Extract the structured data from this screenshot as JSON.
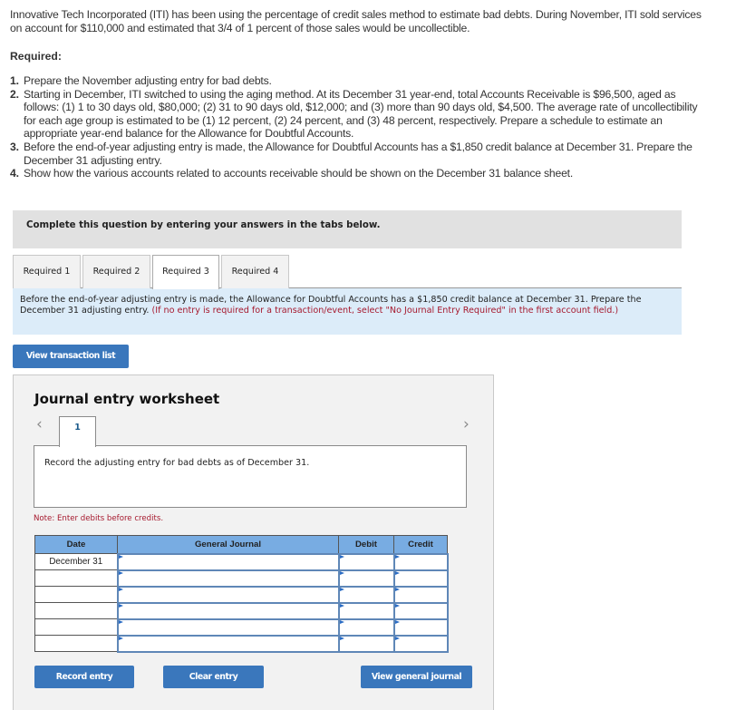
{
  "problem": {
    "intro": "Innovative Tech Incorporated (ITI) has been using the percentage of credit sales method to estimate bad debts. During November, ITI sold services on account for $110,000 and estimated that 3/4 of 1 percent of those sales would be uncollectible.",
    "required_title": "Required:",
    "requirements": [
      {
        "num": "1.",
        "text": "Prepare the November adjusting entry for bad debts."
      },
      {
        "num": "2.",
        "text": "Starting in December, ITI switched to using the aging method. At its December 31 year-end, total Accounts Receivable is $96,500, aged as follows: (1) 1 to 30 days old, $80,000; (2) 31 to 90 days old, $12,000; and (3) more than 90 days old, $4,500. The average rate of uncollectibility for each age group is estimated to be (1) 12 percent, (2) 24 percent, and (3) 48 percent, respectively. Prepare a schedule to estimate an appropriate year-end balance for the Allowance for Doubtful Accounts."
      },
      {
        "num": "3.",
        "text": "Before the end-of-year adjusting entry is made, the Allowance for Doubtful Accounts has a $1,850 credit balance at December 31. Prepare the December 31 adjusting entry."
      },
      {
        "num": "4.",
        "text": "Show how the various accounts related to accounts receivable should be shown on the December 31 balance sheet."
      }
    ]
  },
  "instructions_band": "Complete this question by entering your answers in the tabs below.",
  "tabs": [
    {
      "label": "Required 1",
      "active": false
    },
    {
      "label": "Required 2",
      "active": false
    },
    {
      "label": "Required 3",
      "active": true
    },
    {
      "label": "Required 4",
      "active": false
    }
  ],
  "info_box": {
    "text": "Before the end-of-year adjusting entry is made, the Allowance for Doubtful Accounts has a $1,850 credit balance at December 31. Prepare the December 31 adjusting entry.",
    "note": "(If no entry is required for a transaction/event, select \"No Journal Entry Required\" in the first account field.)"
  },
  "buttons": {
    "view_transaction_list": "View transaction list",
    "record_entry": "Record entry",
    "clear_entry": "Clear entry",
    "view_general_journal": "View general journal"
  },
  "worksheet": {
    "title": "Journal entry worksheet",
    "prev_icon": "‹",
    "next_icon": "›",
    "current_tab": "1",
    "description": "Record the adjusting entry for bad debts as of December 31.",
    "note": "Note: Enter debits before credits.",
    "columns": [
      "Date",
      "General Journal",
      "Debit",
      "Credit"
    ],
    "rows": [
      {
        "date": "December 31",
        "account": "",
        "debit": "",
        "credit": ""
      },
      {
        "date": "",
        "account": "",
        "debit": "",
        "credit": ""
      },
      {
        "date": "",
        "account": "",
        "debit": "",
        "credit": ""
      },
      {
        "date": "",
        "account": "",
        "debit": "",
        "credit": ""
      },
      {
        "date": "",
        "account": "",
        "debit": "",
        "credit": ""
      },
      {
        "date": "",
        "account": "",
        "debit": "",
        "credit": ""
      }
    ]
  },
  "colors": {
    "button_blue": "#3a77bc",
    "info_bg": "#dcecf9",
    "note_red": "#a6192e",
    "table_header": "#78ace2"
  }
}
